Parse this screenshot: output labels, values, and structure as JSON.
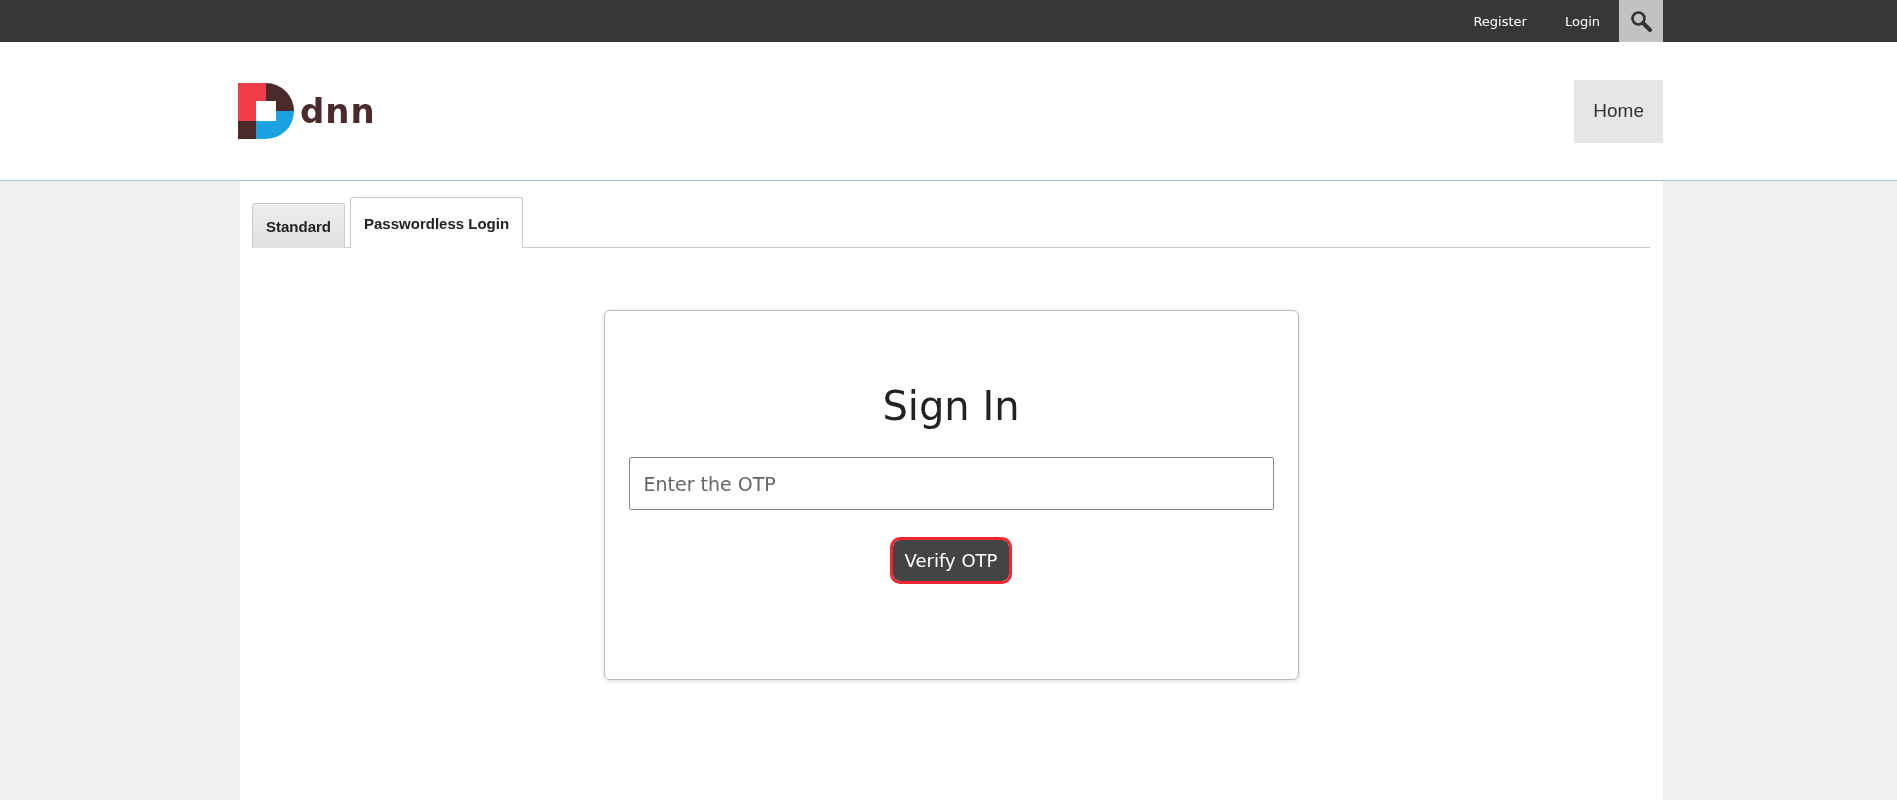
{
  "top_bar": {
    "links": [
      "Register",
      "Login"
    ]
  },
  "header": {
    "logo_text": "dnn",
    "nav": [
      {
        "label": "Home",
        "selected": false
      }
    ]
  },
  "tabs": [
    {
      "label": "Standard",
      "selected": false
    },
    {
      "label": "Passwordless Login",
      "selected": true
    }
  ],
  "card": {
    "title": "Sign In",
    "otp_field": {
      "placeholder": "Enter the OTP"
    },
    "button": {
      "label": "Verify OTP",
      "focused": true
    }
  }
}
